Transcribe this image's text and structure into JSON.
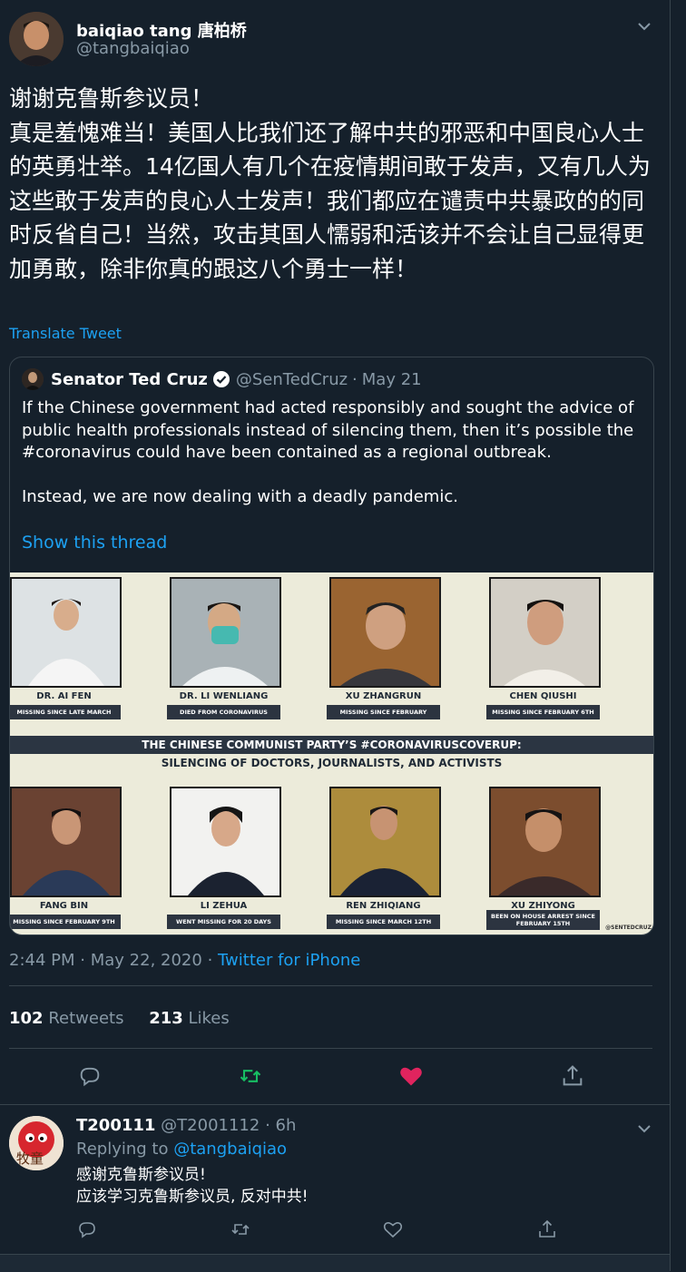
{
  "tweet": {
    "display_name": "baiqiao tang 唐柏桥",
    "handle": "@tangbaiqiao",
    "text": "谢谢克鲁斯参议员！\n真是羞愧难当！美国人比我们还了解中共的邪恶和中国良心人士的英勇壮举。14亿国人有几个在疫情期间敢于发声，又有几人为这些敢于发声的良心人士发声！我们都应在谴责中共暴政的的同时反省自己！当然，攻击其国人懦弱和活该并不会让自己显得更加勇敢，除非你真的跟这八个勇士一样！",
    "translate": "Translate Tweet",
    "time": "2:44 PM",
    "date": "May 22, 2020",
    "source": "Twitter for iPhone",
    "retweets_count": "102",
    "retweets_label": "Retweets",
    "likes_count": "213",
    "likes_label": "Likes"
  },
  "quote": {
    "display_name": "Senator Ted Cruz",
    "handle": "@SenTedCruz",
    "date": "May 21",
    "text": "If the Chinese government had acted responsibly and sought the advice of public health professionals instead of silencing them, then it’s possible the #coronavirus could have been contained as a regional outbreak.\n\nInstead, we are now dealing with a deadly pandemic.",
    "show_thread": "Show this thread",
    "image": {
      "banner_line1": "THE CHINESE COMMUNIST PARTY’S #CORONAVIRUSCOVERUP:",
      "banner_line2": "SILENCING OF DOCTORS, JOURNALISTS, AND ACTIVISTS",
      "watermark": "@SENTEDCRUZ",
      "people": [
        {
          "name": "DR. AI FEN",
          "status": "MISSING SINCE LATE MARCH"
        },
        {
          "name": "DR. LI WENLIANG",
          "status": "DIED FROM CORONAVIRUS"
        },
        {
          "name": "XU ZHANGRUN",
          "status": "MISSING SINCE FEBRUARY"
        },
        {
          "name": "CHEN QIUSHI",
          "status": "MISSING SINCE FEBRUARY 6TH"
        },
        {
          "name": "FANG BIN",
          "status": "MISSING SINCE FEBRUARY 9TH"
        },
        {
          "name": "LI ZEHUA",
          "status": "WENT MISSING FOR 20 DAYS"
        },
        {
          "name": "REN ZHIQIANG",
          "status": "MISSING SINCE MARCH 12TH"
        },
        {
          "name": "XU ZHIYONG",
          "status": "BEEN ON HOUSE ARREST SINCE FEBRUARY 15TH"
        }
      ]
    }
  },
  "reply": {
    "display_name": "T200111",
    "handle": "@T2001112",
    "age": "6h",
    "replying_to_label": "Replying to",
    "replying_to_handle": "@tangbaiqiao",
    "text": "感谢克鲁斯参议员!\n应该学习克鲁斯参议员, 反对中共!",
    "avatar_text": "牧童"
  },
  "separator": "·",
  "colors": {
    "background": "#15202b",
    "accent": "#1da1f2",
    "retweet_active": "#17bf63",
    "like_active": "#e0245e",
    "muted": "#8899a6",
    "border": "#38444d"
  },
  "icons": [
    "chevron-down-icon",
    "verified-badge-icon",
    "reply-icon",
    "retweet-icon",
    "like-icon",
    "share-icon"
  ]
}
